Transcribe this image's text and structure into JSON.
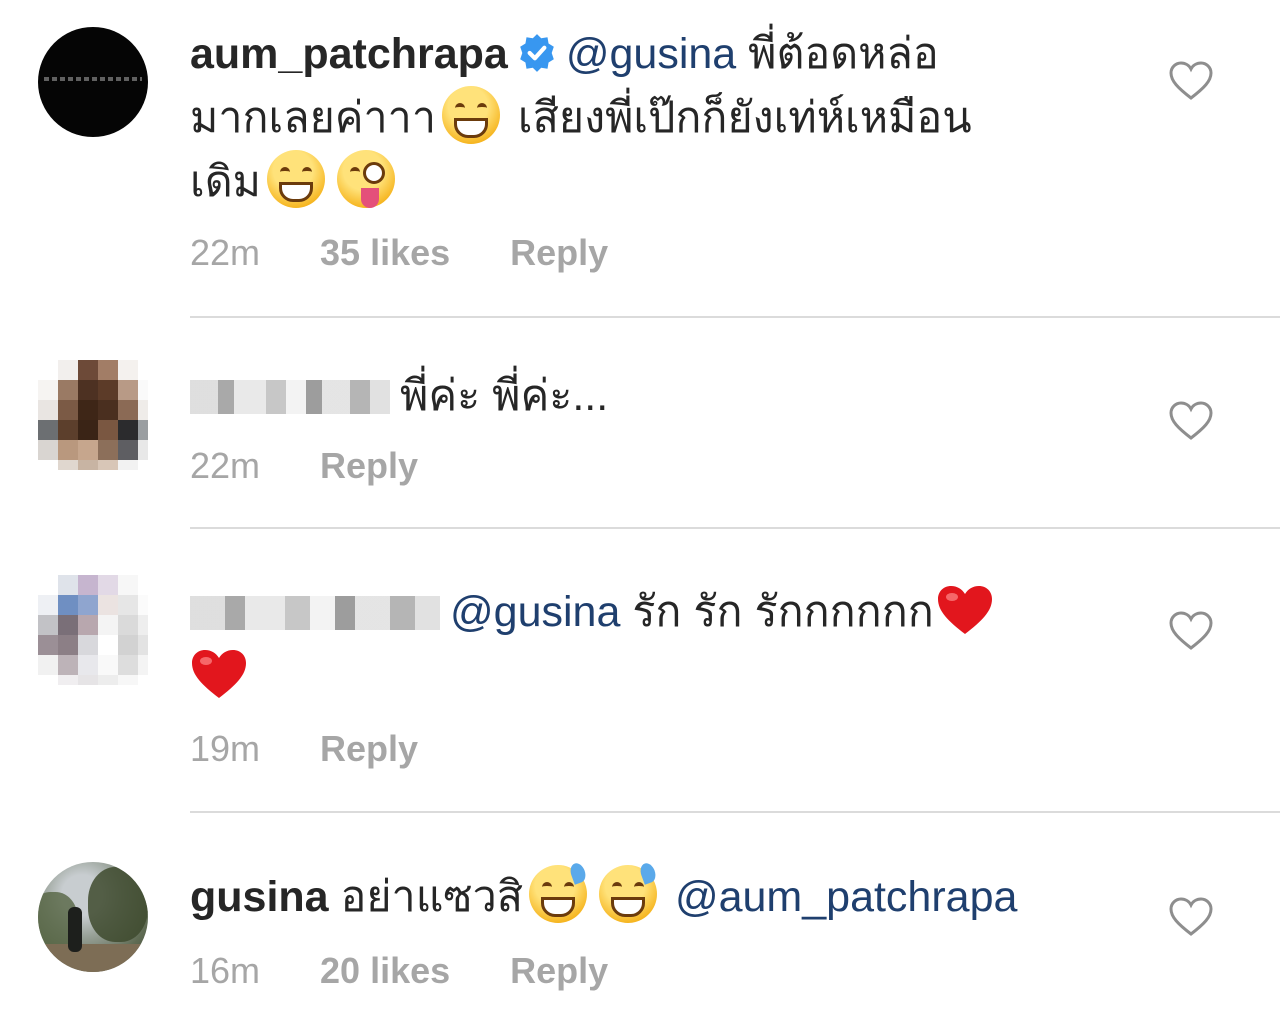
{
  "comments": [
    {
      "username": "aum_patchrapa",
      "mention": "@gusina",
      "text_line1": " พี่ต้อดหล่อ",
      "text_line2": "มากเลยค่าาา",
      "text_line2b": " เสียงพี่เป๊กก็ยังเท่ห์เหมือน",
      "text_line3": "เดิม",
      "time": "22m",
      "likes": "35 likes",
      "reply": "Reply",
      "emojis": [
        "grinning-face",
        "grinning-face",
        "winking-face-tongue"
      ]
    },
    {
      "text": "พี่ค่ะ พี่ค่ะ...",
      "time": "22m",
      "reply": "Reply"
    },
    {
      "mention": "@gusina",
      "text": " รัก รัก รักกกกกก",
      "time": "19m",
      "reply": "Reply",
      "emojis": [
        "red-heart",
        "red-heart"
      ]
    },
    {
      "username": "gusina",
      "text": " อย่าแซวสิ",
      "mention": "@aum_patchrapa",
      "time": "16m",
      "likes": "20 likes",
      "reply": "Reply",
      "emojis": [
        "sweat-smile",
        "sweat-smile"
      ]
    }
  ],
  "colors": {
    "mention": "#1f3f6e",
    "meta": "#a6a6a6",
    "divider": "#dbdbdb",
    "verified": "#3897f0"
  }
}
